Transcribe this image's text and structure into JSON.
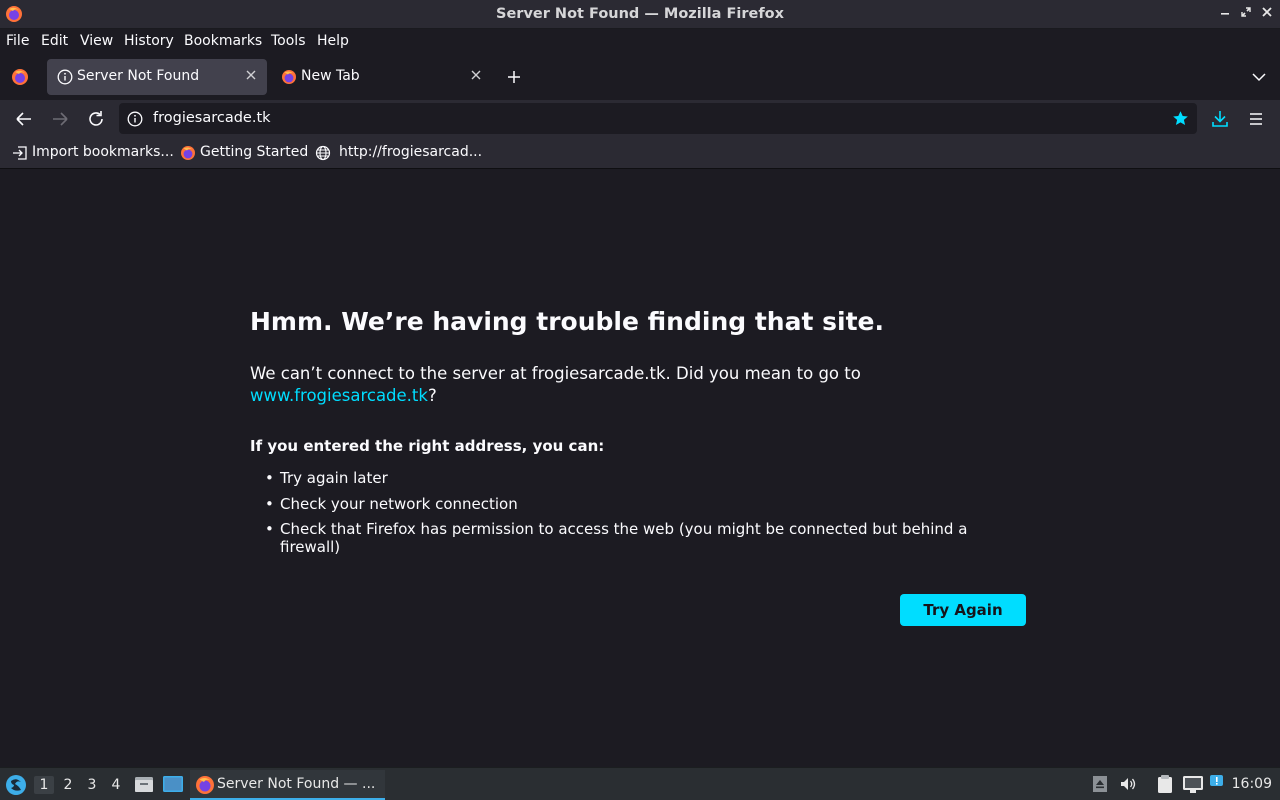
{
  "window": {
    "title": "Server Not Found — Mozilla Firefox"
  },
  "menu": {
    "items": [
      {
        "label": "File"
      },
      {
        "label": "Edit"
      },
      {
        "label": "View"
      },
      {
        "label": "History"
      },
      {
        "label": "Bookmarks"
      },
      {
        "label": "Tools"
      },
      {
        "label": "Help"
      }
    ]
  },
  "tabs": [
    {
      "label": "Server Not Found",
      "active": true,
      "icon": "info-icon"
    },
    {
      "label": "New Tab",
      "active": false,
      "icon": "firefox-icon"
    }
  ],
  "navbar": {
    "url": "frogiesarcade.tk"
  },
  "bookmarks": [
    {
      "label": "Import bookmarks...",
      "icon": "import-icon"
    },
    {
      "label": "Getting Started",
      "icon": "firefox-icon"
    },
    {
      "label": "http://frogiesarcad...",
      "icon": "globe-icon"
    }
  ],
  "error": {
    "title": "Hmm. We’re having trouble finding that site.",
    "desc_prefix": "We can’t connect to the server at frogiesarcade.tk. Did you mean to go to ",
    "suggestion": "www.frogiesarcade.tk",
    "desc_suffix": "?",
    "subtitle": "If you entered the right address, you can:",
    "list": [
      "Try again later",
      "Check your network connection",
      "Check that Firefox has permission to access the web (you might be connected but behind a firewall)"
    ],
    "button": "Try Again"
  },
  "taskbar": {
    "workspaces": [
      "1",
      "2",
      "3",
      "4"
    ],
    "active_workspace": "1",
    "task_label": "Server Not Found — ...",
    "clock": "16:09"
  },
  "colors": {
    "accent": "#00ddff",
    "page_bg": "#1c1b22",
    "toolbar_bg": "#2b2a33",
    "taskbar_bg": "#2a2e32"
  }
}
